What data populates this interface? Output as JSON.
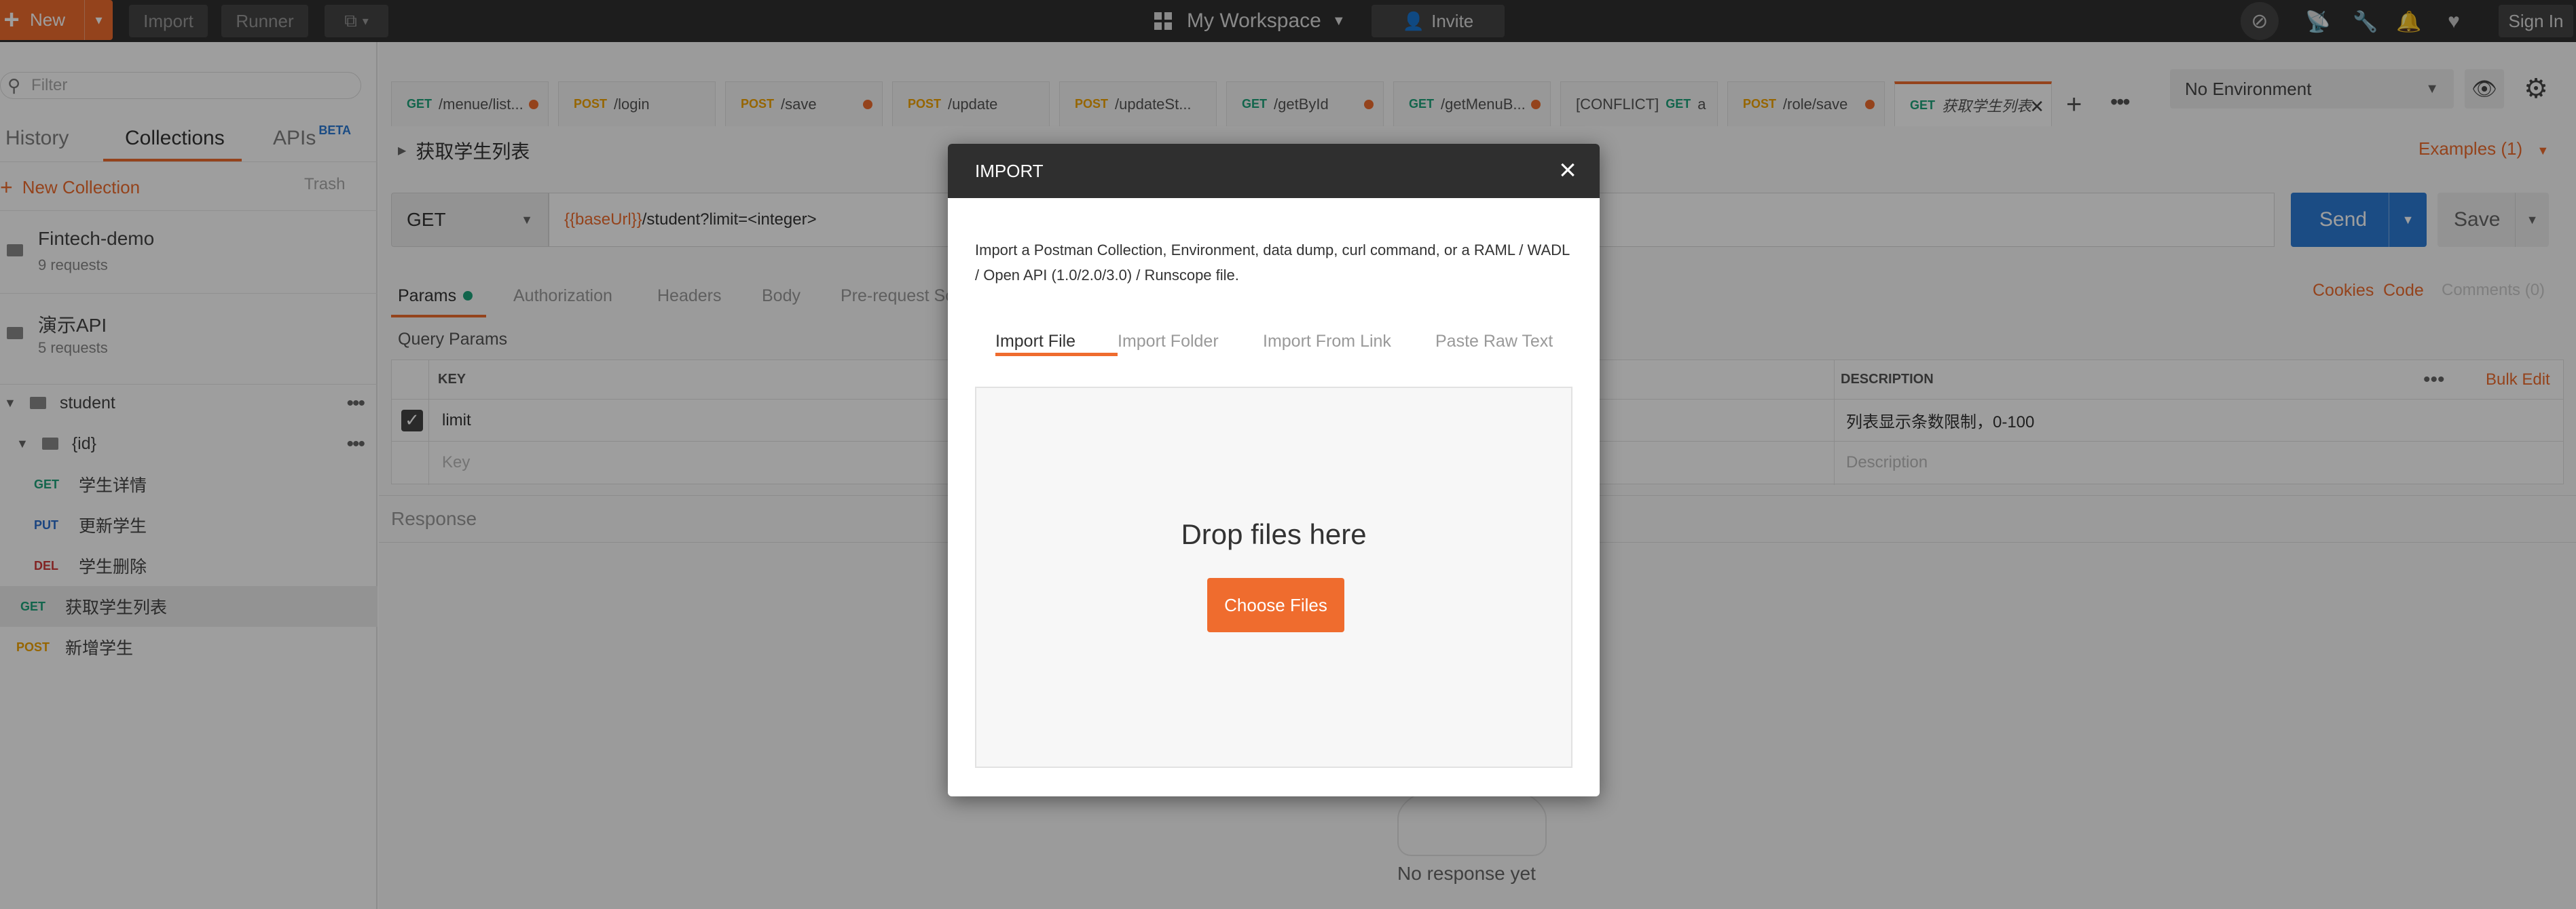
{
  "header": {
    "new_label": "New",
    "import_label": "Import",
    "runner_label": "Runner",
    "workspace_label": "My Workspace",
    "invite_label": "Invite",
    "signin_label": "Sign In",
    "accent": "#ef6c2e"
  },
  "sidebar": {
    "filter_placeholder": "Filter",
    "tabs": [
      "History",
      "Collections",
      "APIs"
    ],
    "beta_badge": "BETA",
    "new_collection": "New Collection",
    "trash": "Trash",
    "collections": [
      {
        "name": "Fintech-demo",
        "requests": "9 requests"
      },
      {
        "name": "演示API",
        "requests": "5 requests"
      }
    ],
    "tree": [
      {
        "label": "student"
      },
      {
        "label": "{id}"
      },
      {
        "method": "GET",
        "label": "学生详情"
      },
      {
        "method": "PUT",
        "label": "更新学生"
      },
      {
        "method": "DEL",
        "label": "学生删除"
      },
      {
        "method": "GET",
        "label": "获取学生列表"
      },
      {
        "method": "POST",
        "label": "新增学生"
      }
    ]
  },
  "tabs": [
    {
      "method": "GET",
      "path": "/menue/list..."
    },
    {
      "method": "POST",
      "path": "/login"
    },
    {
      "method": "POST",
      "path": "/save"
    },
    {
      "method": "POST",
      "path": "/update"
    },
    {
      "method": "POST",
      "path": "/updateSt..."
    },
    {
      "method": "GET",
      "path": "/getById"
    },
    {
      "method": "GET",
      "path": "/getMenuB..."
    },
    {
      "method": "GET",
      "path": "a",
      "prefix": "[CONFLICT]"
    },
    {
      "method": "POST",
      "path": "/role/save"
    },
    {
      "method": "GET",
      "path": "获取学生列表"
    }
  ],
  "environment": {
    "selected": "No Environment"
  },
  "request": {
    "title": "获取学生列表",
    "examples": "Examples (1)",
    "method": "GET",
    "url_var": "{{baseUrl}}",
    "url_rest": "/student?limit=<integer>",
    "send": "Send",
    "save": "Save"
  },
  "subtabs": [
    "Params",
    "Authorization",
    "Headers",
    "Body",
    "Pre-request Scr"
  ],
  "right_links": {
    "cookies": "Cookies",
    "code": "Code",
    "comments": "Comments (0)"
  },
  "params": {
    "section": "Query Params",
    "col_key": "KEY",
    "col_desc": "DESCRIPTION",
    "bulk_edit": "Bulk Edit",
    "row": {
      "key": "limit",
      "description": "列表显示条数限制，0-100"
    },
    "placeholder_key": "Key",
    "placeholder_desc": "Description"
  },
  "response": {
    "label": "Response",
    "empty": "No response yet"
  },
  "modal": {
    "title": "IMPORT",
    "description": "Import a Postman Collection, Environment, data dump, curl command, or a RAML / WADL / Open API (1.0/2.0/3.0) / Runscope file.",
    "tabs": [
      "Import File",
      "Import Folder",
      "Import From Link",
      "Paste Raw Text"
    ],
    "drop_text": "Drop files here",
    "choose_files": "Choose Files"
  }
}
